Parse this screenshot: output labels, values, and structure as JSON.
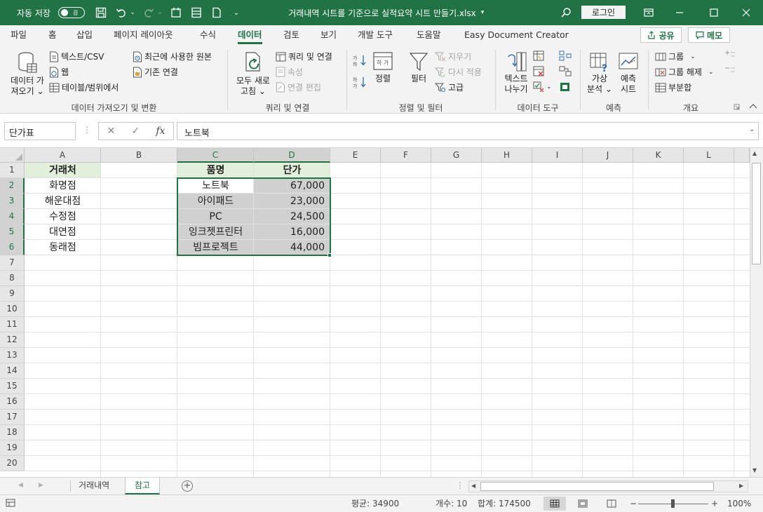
{
  "titlebar": {
    "autosave_label": "자동 저장",
    "autosave_state": "끔",
    "document_title": "거래내역 시트를 기준으로 실적요약 시트 만들기.xlsx",
    "login_label": "로그인"
  },
  "tabs": [
    "파일",
    "홈",
    "삽입",
    "페이지 레이아웃",
    "수식",
    "데이터",
    "검토",
    "보기",
    "개발 도구",
    "도움말",
    "Easy Document Creator"
  ],
  "active_tab": "데이터",
  "share_label": "공유",
  "memo_label": "메모",
  "ribbon": {
    "get_data": {
      "button_line1": "데이터 가",
      "button_line2": "져오기",
      "text_csv": "텍스트/CSV",
      "web": "웹",
      "table_range": "테이블/범위에서",
      "recent_sources": "최근에 사용한 원본",
      "existing_connections": "기존 연결",
      "group_label": "데이터 가져오기 및 변환"
    },
    "queries": {
      "refresh_line1": "모두 새로",
      "refresh_line2": "고침",
      "queries_connections": "쿼리 및 연결",
      "properties": "속성",
      "edit_links": "연결 편집",
      "group_label": "쿼리 및 연결"
    },
    "sort_filter": {
      "sort": "정렬",
      "filter": "필터",
      "clear": "지우기",
      "reapply": "다시 적용",
      "advanced": "고급",
      "group_label": "정렬 및 필터"
    },
    "data_tools": {
      "text_to_columns_line1": "텍스트",
      "text_to_columns_line2": "나누기",
      "group_label": "데이터 도구"
    },
    "forecast": {
      "whatif_line1": "가상",
      "whatif_line2": "분석",
      "sheet_line1": "예측",
      "sheet_line2": "시트",
      "group_label": "예측"
    },
    "outline": {
      "group": "그룹",
      "ungroup": "그룹 해제",
      "subtotal": "부분합",
      "group_label": "개요"
    }
  },
  "formula_bar": {
    "name_box": "단가표",
    "fx": "fx",
    "formula": "노트북"
  },
  "columns": [
    "A",
    "B",
    "C",
    "D",
    "E",
    "F",
    "G",
    "H",
    "I",
    "J",
    "K",
    "L"
  ],
  "rows": [
    "1",
    "2",
    "3",
    "4",
    "5",
    "6",
    "7",
    "8",
    "9",
    "10",
    "11",
    "12",
    "13",
    "14",
    "15",
    "16",
    "17",
    "18",
    "19",
    "20"
  ],
  "cells": {
    "A1": "거래처",
    "C1": "품명",
    "D1": "단가",
    "A": [
      "화명점",
      "해운대점",
      "수정점",
      "대연점",
      "동래점"
    ],
    "C": [
      "노트북",
      "아이패드",
      "PC",
      "잉크젯프린터",
      "빔프로젝트"
    ],
    "D": [
      "67,000",
      "23,000",
      "24,500",
      "16,000",
      "44,000"
    ]
  },
  "sheets": [
    "거래내역",
    "참고"
  ],
  "active_sheet": "참고",
  "status": {
    "average": "평균: 34900",
    "count": "개수: 10",
    "sum": "합계: 174500",
    "zoom": "100%"
  },
  "colors": {
    "excel_green": "#217346",
    "header_fill": "#e2efda",
    "selection_fill": "#d0d0d0"
  }
}
